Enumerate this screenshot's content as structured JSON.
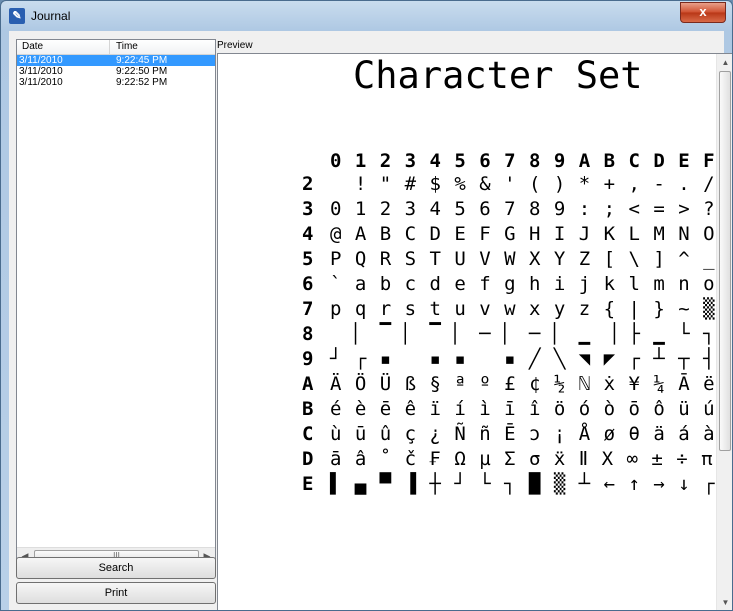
{
  "window": {
    "title": "Journal",
    "close_label": "x"
  },
  "list": {
    "headers": {
      "date": "Date",
      "time": "Time"
    },
    "rows": [
      {
        "date": "3/11/2010",
        "time": "9:22:45 PM",
        "selected": true
      },
      {
        "date": "3/11/2010",
        "time": "9:22:50 PM",
        "selected": false
      },
      {
        "date": "3/11/2010",
        "time": "9:22:52 PM",
        "selected": false
      }
    ],
    "scroll_grip": "III"
  },
  "buttons": {
    "search": "Search",
    "print": "Print"
  },
  "preview": {
    "label": "Preview",
    "title": "Character Set",
    "columns": "0 1 2 3 4 5 6 7 8 9 A B C D E F",
    "rows": [
      {
        "label": "2",
        "chars": "  ! \" # $ % & ' ( ) * + , - . /"
      },
      {
        "label": "3",
        "chars": "0 1 2 3 4 5 6 7 8 9 : ; < = > ?"
      },
      {
        "label": "4",
        "chars": "@ A B C D E F G H I J K L M N O"
      },
      {
        "label": "5",
        "chars": "P Q R S T U V W X Y Z [ \\ ] ^ _"
      },
      {
        "label": "6",
        "chars": "` a b c d e f g h i j k l m n o"
      },
      {
        "label": "7",
        "chars": "p q r s t u v w x y z { | } ~ ▒"
      },
      {
        "label": "8",
        "chars": "  ▏ ▔ ▏ ▔ ▏ ─ ▏ ─ ▏ ▁ ▕ ├ ▁ └ ┐"
      },
      {
        "label": "9",
        "chars": "┘ ┌ ▪   ▪ ▪   ▪ ╱ ╲ ◥ ◤ ┌ ┴ ┬ ┤ ♦ ╳"
      },
      {
        "label": "A",
        "chars": "Ä Ö Ü ß § ª º £ ¢ ½ ℕ ẋ ¥ ¼ Ā ë"
      },
      {
        "label": "B",
        "chars": "é è ē ê ï í ì ī î ö ó ò ō ô ü ú"
      },
      {
        "label": "C",
        "chars": "ù ū û ç ¿ Ñ ñ Ē ɔ ¡ Å ø θ ä á à"
      },
      {
        "label": "D",
        "chars": "ā â ˚ č ₣ Ω µ Σ σ ẍ Ⅱ Χ ∞ ± ÷ π"
      },
      {
        "label": "E",
        "chars": "▌ ▄ ▀ ▐ ┼ ┘ └ ┐ █ ▒ ┴ ← ↑ → ↓ ┌"
      }
    ]
  }
}
